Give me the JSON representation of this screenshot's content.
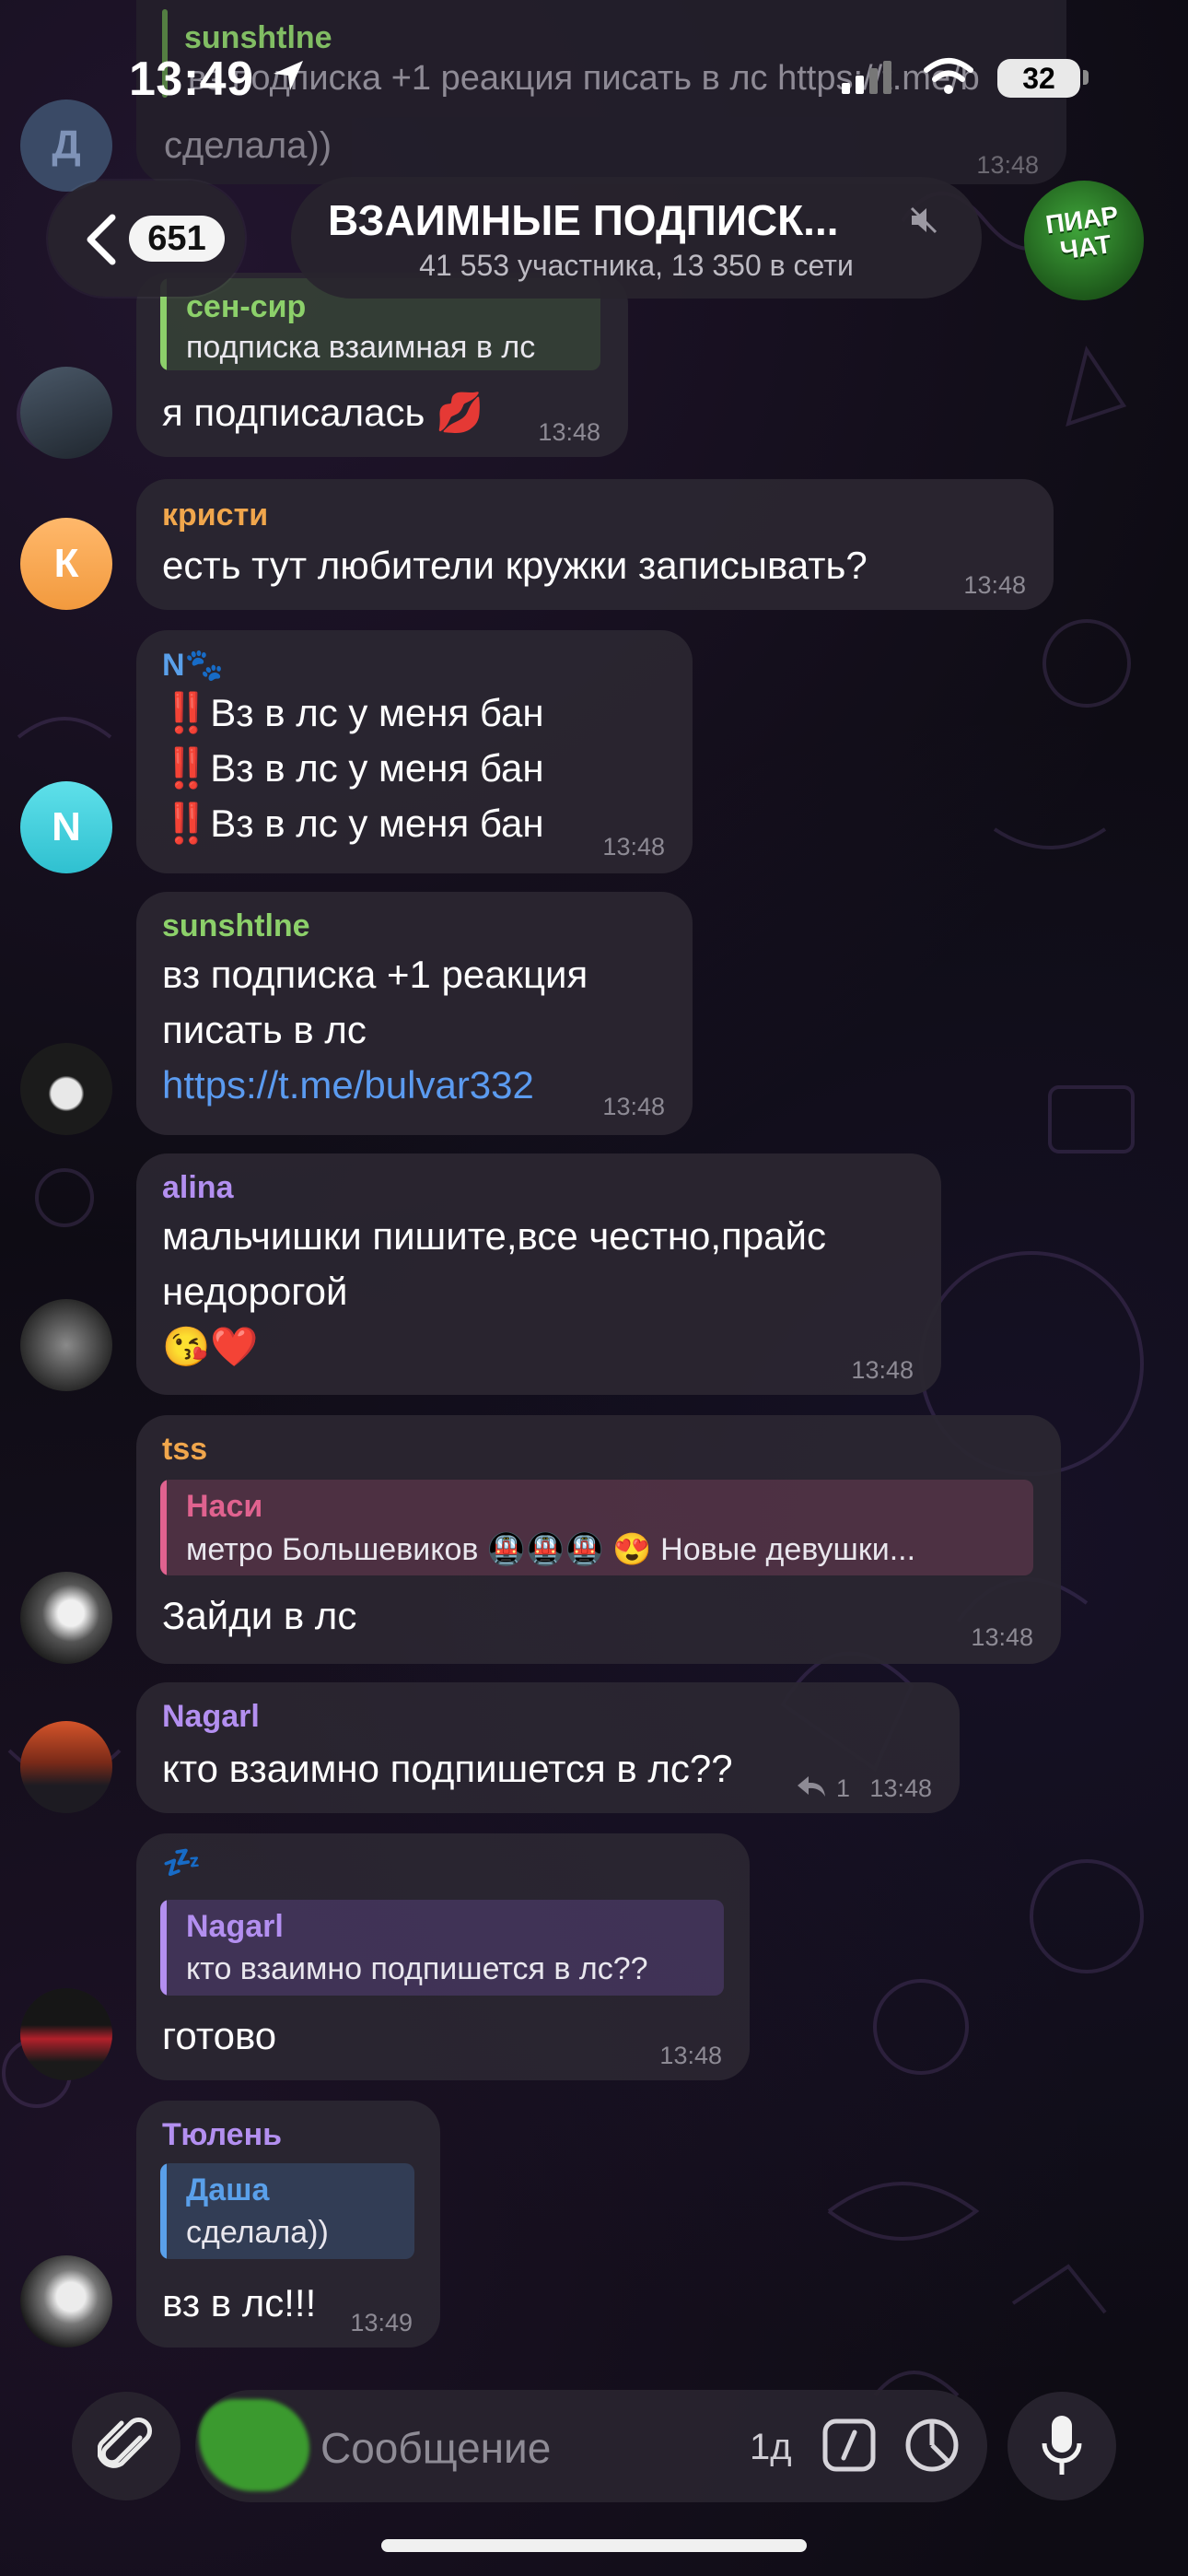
{
  "status_bar": {
    "time": "13:49",
    "battery": "32"
  },
  "top_pinned": {
    "name": "sunshtlne",
    "text": "вз подписка +1 реакция писать в лс https://t.me/b",
    "text2": "сделала))",
    "time": "13:48"
  },
  "header": {
    "back_count": "651",
    "title": "ВЗАИМНЫЕ ПОДПИСК...",
    "subtitle": "41 553 участника, 13 350 в сети",
    "avatar_text": "ПИАР ЧАТ"
  },
  "messages": [
    {
      "quote_name": "сен-сир",
      "quote_text": "подписка взаимная в лс",
      "text": "я подписалась 💋",
      "time": "13:48"
    },
    {
      "sender": "кристи",
      "text": "есть тут любители кружки записывать?",
      "time": "13:48",
      "avatar_letter": "К"
    },
    {
      "sender": "N🐾",
      "lines": [
        "‼️Вз в лс у меня бан",
        "‼️Вз в лс у меня бан",
        "‼️Вз в лс у меня бан"
      ],
      "time": "13:48",
      "avatar_letter": "N"
    },
    {
      "sender": "sunshtlne",
      "lines": [
        "вз подписка +1 реакция",
        "писать в лс"
      ],
      "link": "https://t.me/bulvar332",
      "time": "13:48"
    },
    {
      "sender": "alina",
      "lines": [
        "мальчишки пишите,все честно,прайс",
        "недорогой",
        "😘❤️"
      ],
      "time": "13:48"
    },
    {
      "sender": "tss",
      "quote_name": "Наси",
      "quote_text": "метро Большевиков 🚇🚇🚇 😍 Новые девушки...",
      "text": "Зайди в лс",
      "time": "13:48"
    },
    {
      "sender": "Nagarl",
      "text": "кто взаимно подпишется в лс??",
      "reply_count": "1",
      "time": "13:48"
    },
    {
      "sender": "💤",
      "quote_name": "Nagarl",
      "quote_text": "кто взаимно подпишется в лс??",
      "text": "готово",
      "time": "13:48"
    },
    {
      "sender": "Тюлень",
      "quote_name": "Даша",
      "quote_text": "сделала))",
      "text": "вз в лс!!!",
      "time": "13:49"
    }
  ],
  "input": {
    "placeholder": "Сообщение",
    "timer": "1д"
  },
  "colors": {
    "green_name": "#8cd06a",
    "orange_name": "#f0a64c",
    "blue_name": "#5aa0ea",
    "purple_name": "#b38ff0",
    "pink_name": "#e0628f",
    "link": "#5b9bf0"
  }
}
